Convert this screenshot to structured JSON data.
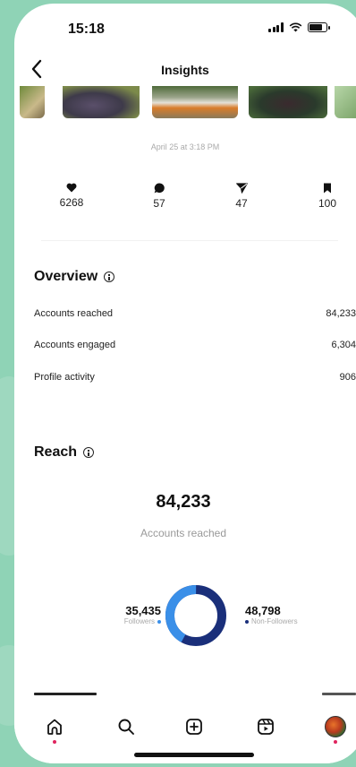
{
  "status_bar": {
    "time": "15:18",
    "battery_level": 0.8
  },
  "header": {
    "title": "Insights"
  },
  "post": {
    "date": "April 25 at 3:18 PM",
    "thumbnail_colors": [
      "#6f8a3c",
      "#3e3a4a",
      "#8a7a5a",
      "#2a3a2c",
      "#b7d6a8"
    ]
  },
  "stats": {
    "likes": "6268",
    "comments": "57",
    "shares": "47",
    "saves": "100"
  },
  "overview": {
    "title": "Overview",
    "rows": [
      {
        "label": "Accounts reached",
        "value": "84,233"
      },
      {
        "label": "Accounts engaged",
        "value": "6,304"
      },
      {
        "label": "Profile activity",
        "value": "906"
      }
    ]
  },
  "reach": {
    "title": "Reach",
    "total": "84,233",
    "total_label": "Accounts reached",
    "followers_value": "35,435",
    "followers_label": "Followers",
    "non_followers_value": "48,798",
    "non_followers_label": "Non-Followers",
    "followers_fraction": 0.42
  },
  "colors": {
    "followers": "#3a8fe8",
    "non_followers": "#1a2f7a",
    "notification_dot": "#e0245e",
    "background": "#8fd3b6"
  },
  "tab_bar": {
    "icons": [
      "home-icon",
      "search-icon",
      "create-icon",
      "reels-icon",
      "profile-avatar"
    ]
  }
}
